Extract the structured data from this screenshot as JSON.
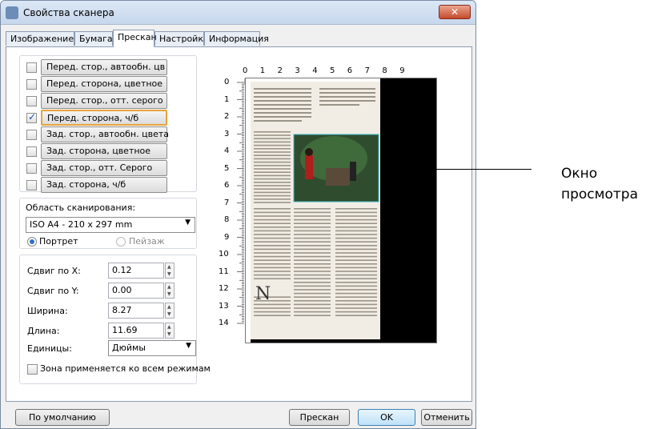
{
  "window": {
    "title": "Свойства сканера",
    "close_label": "✕"
  },
  "tabs": [
    "Изображение",
    "Бумага",
    "Прескан",
    "Настройка",
    "Информация"
  ],
  "modes": [
    {
      "label": "Перед. стор., автообн. цв",
      "checked": false
    },
    {
      "label": "Перед. сторона, цветное",
      "checked": false
    },
    {
      "label": "Перед. стор., отт. серого",
      "checked": false
    },
    {
      "label": "Перед. сторона, ч/б",
      "checked": true
    },
    {
      "label": "Зад. стор., автообн. цвета",
      "checked": false
    },
    {
      "label": "Зад. сторона, цветное",
      "checked": false
    },
    {
      "label": "Зад. стор., отт. Серого",
      "checked": false
    },
    {
      "label": "Зад. сторона, ч/б",
      "checked": false
    }
  ],
  "scan_area": {
    "label": "Область сканирования:",
    "value": "ISO A4 - 210 x 297 mm",
    "portrait": "Портрет",
    "landscape": "Пейзаж"
  },
  "fields": [
    {
      "label": "Сдвиг по X:",
      "value": "0.12"
    },
    {
      "label": "Сдвиг по Y:",
      "value": "0.00"
    },
    {
      "label": "Ширина:",
      "value": "8.27"
    },
    {
      "label": "Длина:",
      "value": "11.69"
    }
  ],
  "units": {
    "label": "Единицы:",
    "value": "Дюймы"
  },
  "apply_all": "Зона применяется ко всем режимам",
  "ruler_top": [
    "0",
    "1",
    "2",
    "3",
    "4",
    "5",
    "6",
    "7",
    "8",
    "9"
  ],
  "ruler_left": [
    "0",
    "1",
    "2",
    "3",
    "4",
    "5",
    "6",
    "7",
    "8",
    "9",
    "10",
    "11",
    "12",
    "13",
    "14"
  ],
  "buttons": {
    "default": "По умолчанию",
    "prescan": "Прескан",
    "ok": "OK",
    "cancel": "Отменить"
  },
  "annotation": {
    "line1": "Окно",
    "line2": "просмотра"
  },
  "colors": {
    "accent_selected": "#e8a23c",
    "preview_black": "#000000"
  }
}
